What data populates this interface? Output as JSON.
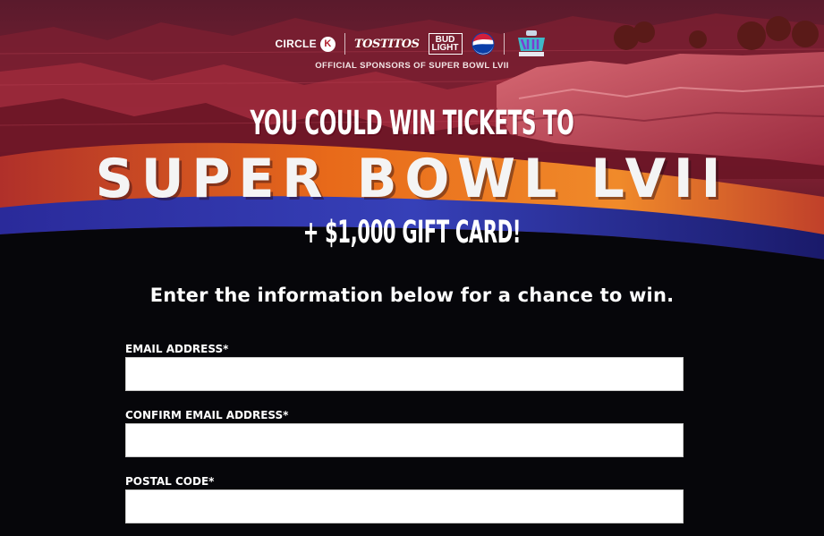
{
  "sponsors": {
    "circle_k": "CIRCLE",
    "circle_k_mark": "K",
    "tostitos": "TOSTITOS",
    "bud_light_line1": "BUD",
    "bud_light_line2": "LIGHT",
    "caption": "OFFICIAL SPONSORS OF SUPER BOWL LVII"
  },
  "hero": {
    "line1": "YOU COULD WIN TICKETS TO",
    "line2": "SUPER BOWL LVII",
    "line3": "+ $1,000 GIFT CARD!"
  },
  "form": {
    "intro": "Enter the information below for a chance to win.",
    "fields": [
      {
        "label": "EMAIL ADDRESS*",
        "value": "",
        "placeholder": ""
      },
      {
        "label": "CONFIRM EMAIL ADDRESS*",
        "value": "",
        "placeholder": ""
      },
      {
        "label": "POSTAL CODE*",
        "value": "",
        "placeholder": ""
      }
    ]
  },
  "colors": {
    "background": "#06060a",
    "canyon_red": "#b8324a",
    "swoosh_orange": "#e8661e",
    "swoosh_blue": "#2a36a8"
  }
}
